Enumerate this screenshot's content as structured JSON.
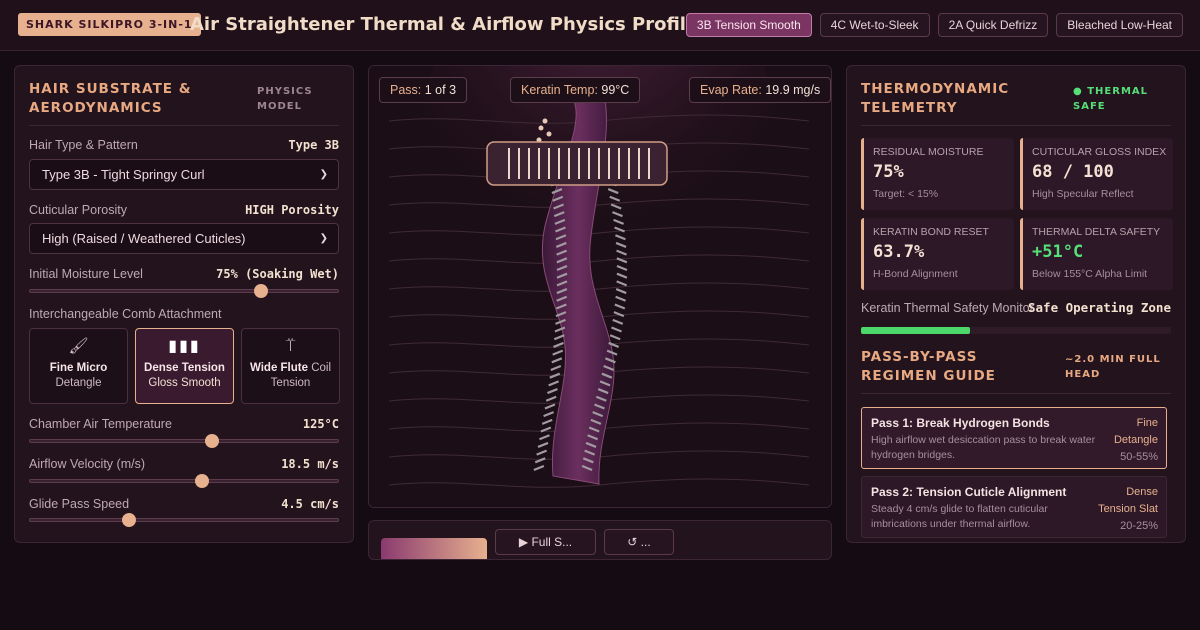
{
  "header": {
    "brand": "SHARK SILKIPRO 3-IN-1",
    "title": "Air Straightener Thermal & Airflow Physics Profiler",
    "presets": [
      {
        "label": "3B Tension Smooth",
        "active": true
      },
      {
        "label": "4C Wet-to-Sleek",
        "active": false
      },
      {
        "label": "2A Quick Defrizz",
        "active": false
      },
      {
        "label": "Bleached Low-Heat",
        "active": false
      }
    ]
  },
  "left": {
    "title": "HAIR SUBSTRATE & AERODYNAMICS",
    "tag": "PHYSICS MODEL",
    "hair_type": {
      "label": "Hair Type & Pattern",
      "value": "Type 3B",
      "selected": "Type 3B - Tight Springy Curl"
    },
    "porosity": {
      "label": "Cuticular Porosity",
      "value": "HIGH Porosity",
      "selected": "High (Raised / Weathered Cuticles)"
    },
    "moisture": {
      "label": "Initial Moisture Level",
      "value": "75% (Soaking Wet)",
      "level": 0.75
    },
    "comb_label": "Interchangeable Comb Attachment",
    "combs": [
      {
        "icon": "brush-icon",
        "glyph": "🖌",
        "name": "Fine Micro",
        "sub": "Detangle",
        "active": false
      },
      {
        "icon": "dense-comb-icon",
        "glyph": "▮▮▮",
        "name": "Dense Tension",
        "sub": "Gloss Smooth",
        "active": true
      },
      {
        "icon": "wide-flute-icon",
        "glyph": "⍡",
        "name": "Wide Flute",
        "name_tail": "Coil",
        "sub": "Tension",
        "active": false
      }
    ],
    "temperature": {
      "label": "Chamber Air Temperature",
      "value": "125°C",
      "level": 0.59
    },
    "airflow": {
      "label": "Airflow Velocity (m/s)",
      "value": "18.5 m/s",
      "level": 0.56
    },
    "glide": {
      "label": "Glide Pass Speed",
      "value": "4.5 cm/s",
      "level": 0.32
    }
  },
  "center": {
    "pass": {
      "label": "Pass:",
      "value": "1 of 3"
    },
    "keratin": {
      "label": "Keratin Temp:",
      "value": "99°C"
    },
    "evap": {
      "label": "Evap Rate:",
      "value": "19.9 mg/s"
    },
    "bottom_buttons": [
      "",
      "▶ Full S...",
      "↺ ..."
    ]
  },
  "right": {
    "title": "THERMODYNAMIC TELEMETRY",
    "status": "THERMAL SAFE",
    "metrics": [
      {
        "label": "RESIDUAL MOISTURE",
        "value": "75%",
        "sub": "Target: < 15%",
        "green": false
      },
      {
        "label": "CUTICULAR GLOSS INDEX",
        "value": "68 / 100",
        "sub": "High Specular Reflect",
        "green": false
      },
      {
        "label": "KERATIN BOND RESET",
        "value": "63.7%",
        "sub": "H-Bond Alignment",
        "green": false
      },
      {
        "label": "THERMAL DELTA SAFETY",
        "value": "+51°C",
        "sub": "Below 155°C Alpha Limit",
        "green": true
      }
    ],
    "safety": {
      "label": "Keratin Thermal Safety Monitor",
      "value": "Safe Operating Zone",
      "level": 0.35
    },
    "guide_title": "PASS-BY-PASS REGIMEN GUIDE",
    "guide_tag": "~2.0 MIN FULL HEAD",
    "passes": [
      {
        "title": "Pass 1: Break Hydrogen Bonds",
        "desc": "High airflow wet desiccation pass to break water hydrogen bridges.",
        "comb1": "Fine",
        "comb2": "Detangle",
        "pct": "50-55%",
        "active": true
      },
      {
        "title": "Pass 2: Tension Cuticle Alignment",
        "desc": "Steady 4 cm/s glide to flatten cuticular imbrications under thermal airflow.",
        "comb1": "Dense",
        "comb2": "Tension Slat",
        "pct": "20-25%",
        "active": false
      }
    ]
  },
  "colors": {
    "accent": "#e7b08e",
    "active": "#7a3563",
    "safe": "#4cd76a",
    "bg": "#150b12"
  }
}
